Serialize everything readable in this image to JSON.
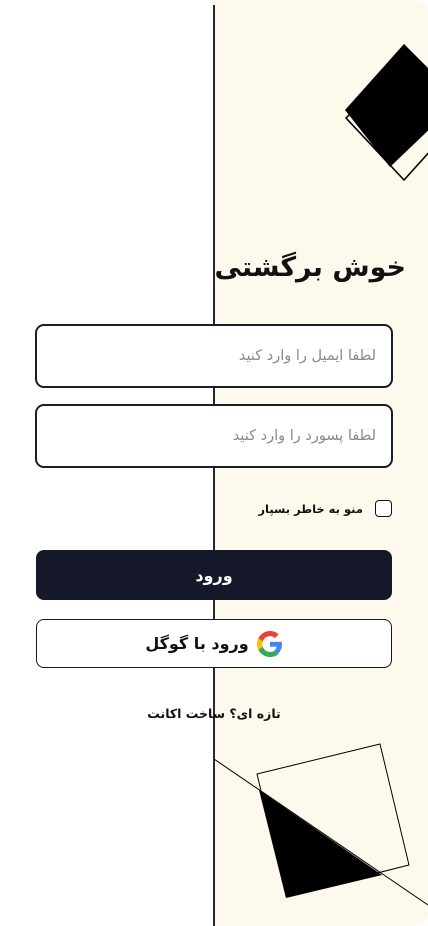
{
  "login": {
    "welcome_title": "خوش برگشتی",
    "email_placeholder": "لطفا ایمیل را وارد کنید",
    "password_placeholder": "لطفا پسورد را وارد کنید",
    "remember_label": "منو به خاطر بسپار",
    "remember_checked": false,
    "submit_label": "ورود",
    "google_label": "ورود با گوگل",
    "signup_prompt": "تازه ای؟",
    "signup_link": "ساخت اکانت"
  },
  "theme": {
    "panel_background": "#fdf9ec",
    "primary_button": "#141828",
    "border": "#1a1d29",
    "google_colors": [
      "#4285F4",
      "#34A853",
      "#FBBC05",
      "#EA4335"
    ]
  },
  "icons": {
    "google": "google-g-icon",
    "checkbox": "checkbox-icon"
  }
}
